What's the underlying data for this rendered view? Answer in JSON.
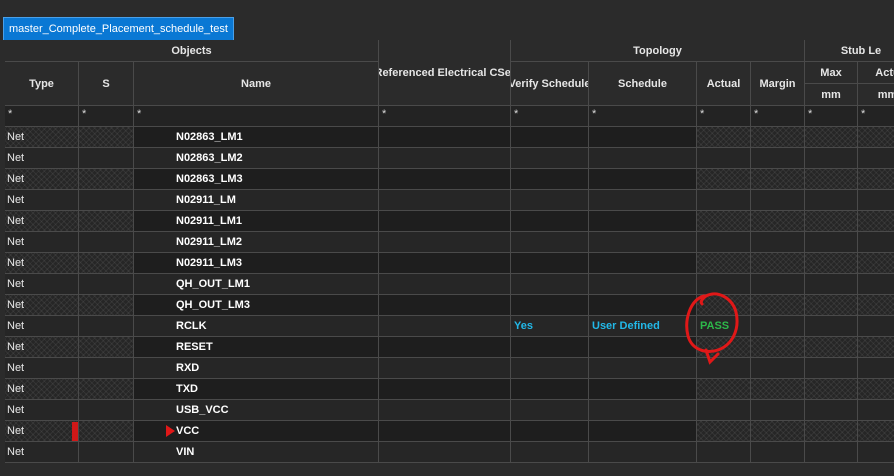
{
  "tab": {
    "title": "master_Complete_Placement_schedule_test"
  },
  "groups": {
    "objects": "Objects",
    "topology": "Topology",
    "stub": "Stub Le"
  },
  "columns": {
    "type": "Type",
    "s": "S",
    "name": "Name",
    "ref_cset": "Referenced Electrical CSet",
    "verify_schedule": "Verify Schedule",
    "schedule": "Schedule",
    "actual": "Actual",
    "margin": "Margin",
    "max": "Max",
    "stub_actual": "Actu",
    "unit_max": "mm",
    "unit_actual": "mm"
  },
  "filter_symbol": "*",
  "rows": [
    {
      "type": "Net",
      "name": "N02863_LM1"
    },
    {
      "type": "Net",
      "name": "N02863_LM2"
    },
    {
      "type": "Net",
      "name": "N02863_LM3"
    },
    {
      "type": "Net",
      "name": "N02911_LM"
    },
    {
      "type": "Net",
      "name": "N02911_LM1"
    },
    {
      "type": "Net",
      "name": "N02911_LM2"
    },
    {
      "type": "Net",
      "name": "N02911_LM3"
    },
    {
      "type": "Net",
      "name": "QH_OUT_LM1"
    },
    {
      "type": "Net",
      "name": "QH_OUT_LM3"
    },
    {
      "type": "Net",
      "name": "RCLK",
      "verify": "Yes",
      "schedule": "User Defined",
      "actual": "PASS"
    },
    {
      "type": "Net",
      "name": "RESET"
    },
    {
      "type": "Net",
      "name": "RXD"
    },
    {
      "type": "Net",
      "name": "TXD"
    },
    {
      "type": "Net",
      "name": "USB_VCC"
    },
    {
      "type": "Net",
      "name": "VCC"
    },
    {
      "type": "Net",
      "name": "VIN"
    }
  ],
  "colors": {
    "selection": "#0a78d4",
    "value_text": "#22b8e8",
    "pass": "#2db84a",
    "annotation": "#e01818"
  }
}
